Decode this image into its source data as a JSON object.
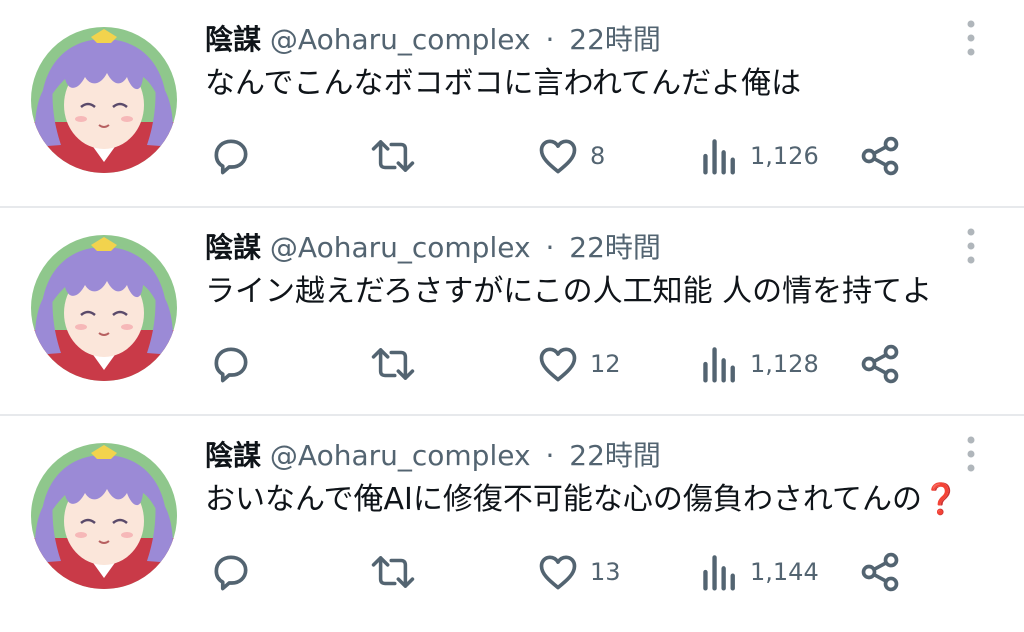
{
  "tweets": [
    {
      "name": "陰謀",
      "handle": "@Aoharu_complex",
      "dot": "·",
      "time": "22時間",
      "text": "なんでこんなボコボコに言われてんだよ俺は",
      "emoji": "",
      "likes": "8",
      "views": "1,126"
    },
    {
      "name": "陰謀",
      "handle": "@Aoharu_complex",
      "dot": "·",
      "time": "22時間",
      "text": "ライン越えだろさすがにこの人工知能 人の情を持てよ",
      "emoji": "",
      "likes": "12",
      "views": "1,128"
    },
    {
      "name": "陰謀",
      "handle": "@Aoharu_complex",
      "dot": "·",
      "time": "22時間",
      "text": "おいなんで俺AIに修復不可能な心の傷負わされてんの",
      "emoji": "❓",
      "likes": "13",
      "views": "1,144"
    }
  ],
  "icons": {
    "reply": "reply-icon",
    "retweet": "retweet-icon",
    "like": "heart-icon",
    "views": "views-icon",
    "share": "share-icon",
    "more": "more-vertical-icon",
    "avatar": "avatar-image"
  },
  "colors": {
    "text": "#0f1419",
    "secondary": "#536471",
    "divider": "#e7e9ec",
    "question_mark": "#c8102e"
  }
}
